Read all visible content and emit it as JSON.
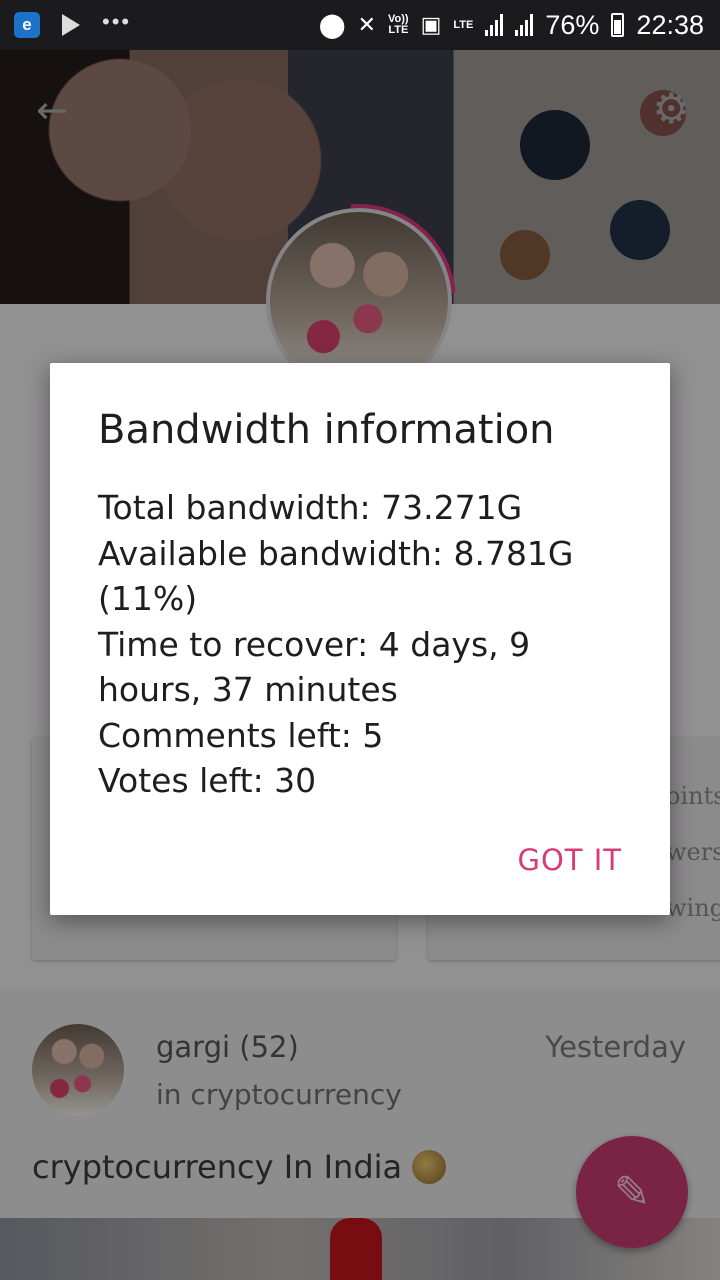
{
  "status_bar": {
    "volte_label": "Vo))",
    "lte_label": "LTE",
    "lte2_label": "LTE",
    "battery": "76%",
    "time": "22:38"
  },
  "profile": {
    "back_icon": "arrow-left-icon",
    "settings_icon": "gear-icon"
  },
  "cards": {
    "right_labels": [
      "oints",
      "wers",
      "wing"
    ]
  },
  "post": {
    "author": "gargi (52)",
    "time": "Yesterday",
    "category": "in cryptocurrency",
    "title": "cryptocurrency In India"
  },
  "dialog": {
    "title": "Bandwidth information",
    "lines": [
      "Total bandwidth: 73.271G",
      "Available bandwidth: 8.781G (11%)",
      "Time to recover: 4 days, 9 hours, 37 minutes",
      "Comments left: 5",
      "Votes left: 30"
    ],
    "button": "GOT IT"
  },
  "colors": {
    "accent": "#d63d77",
    "fab": "#c43b6c"
  }
}
